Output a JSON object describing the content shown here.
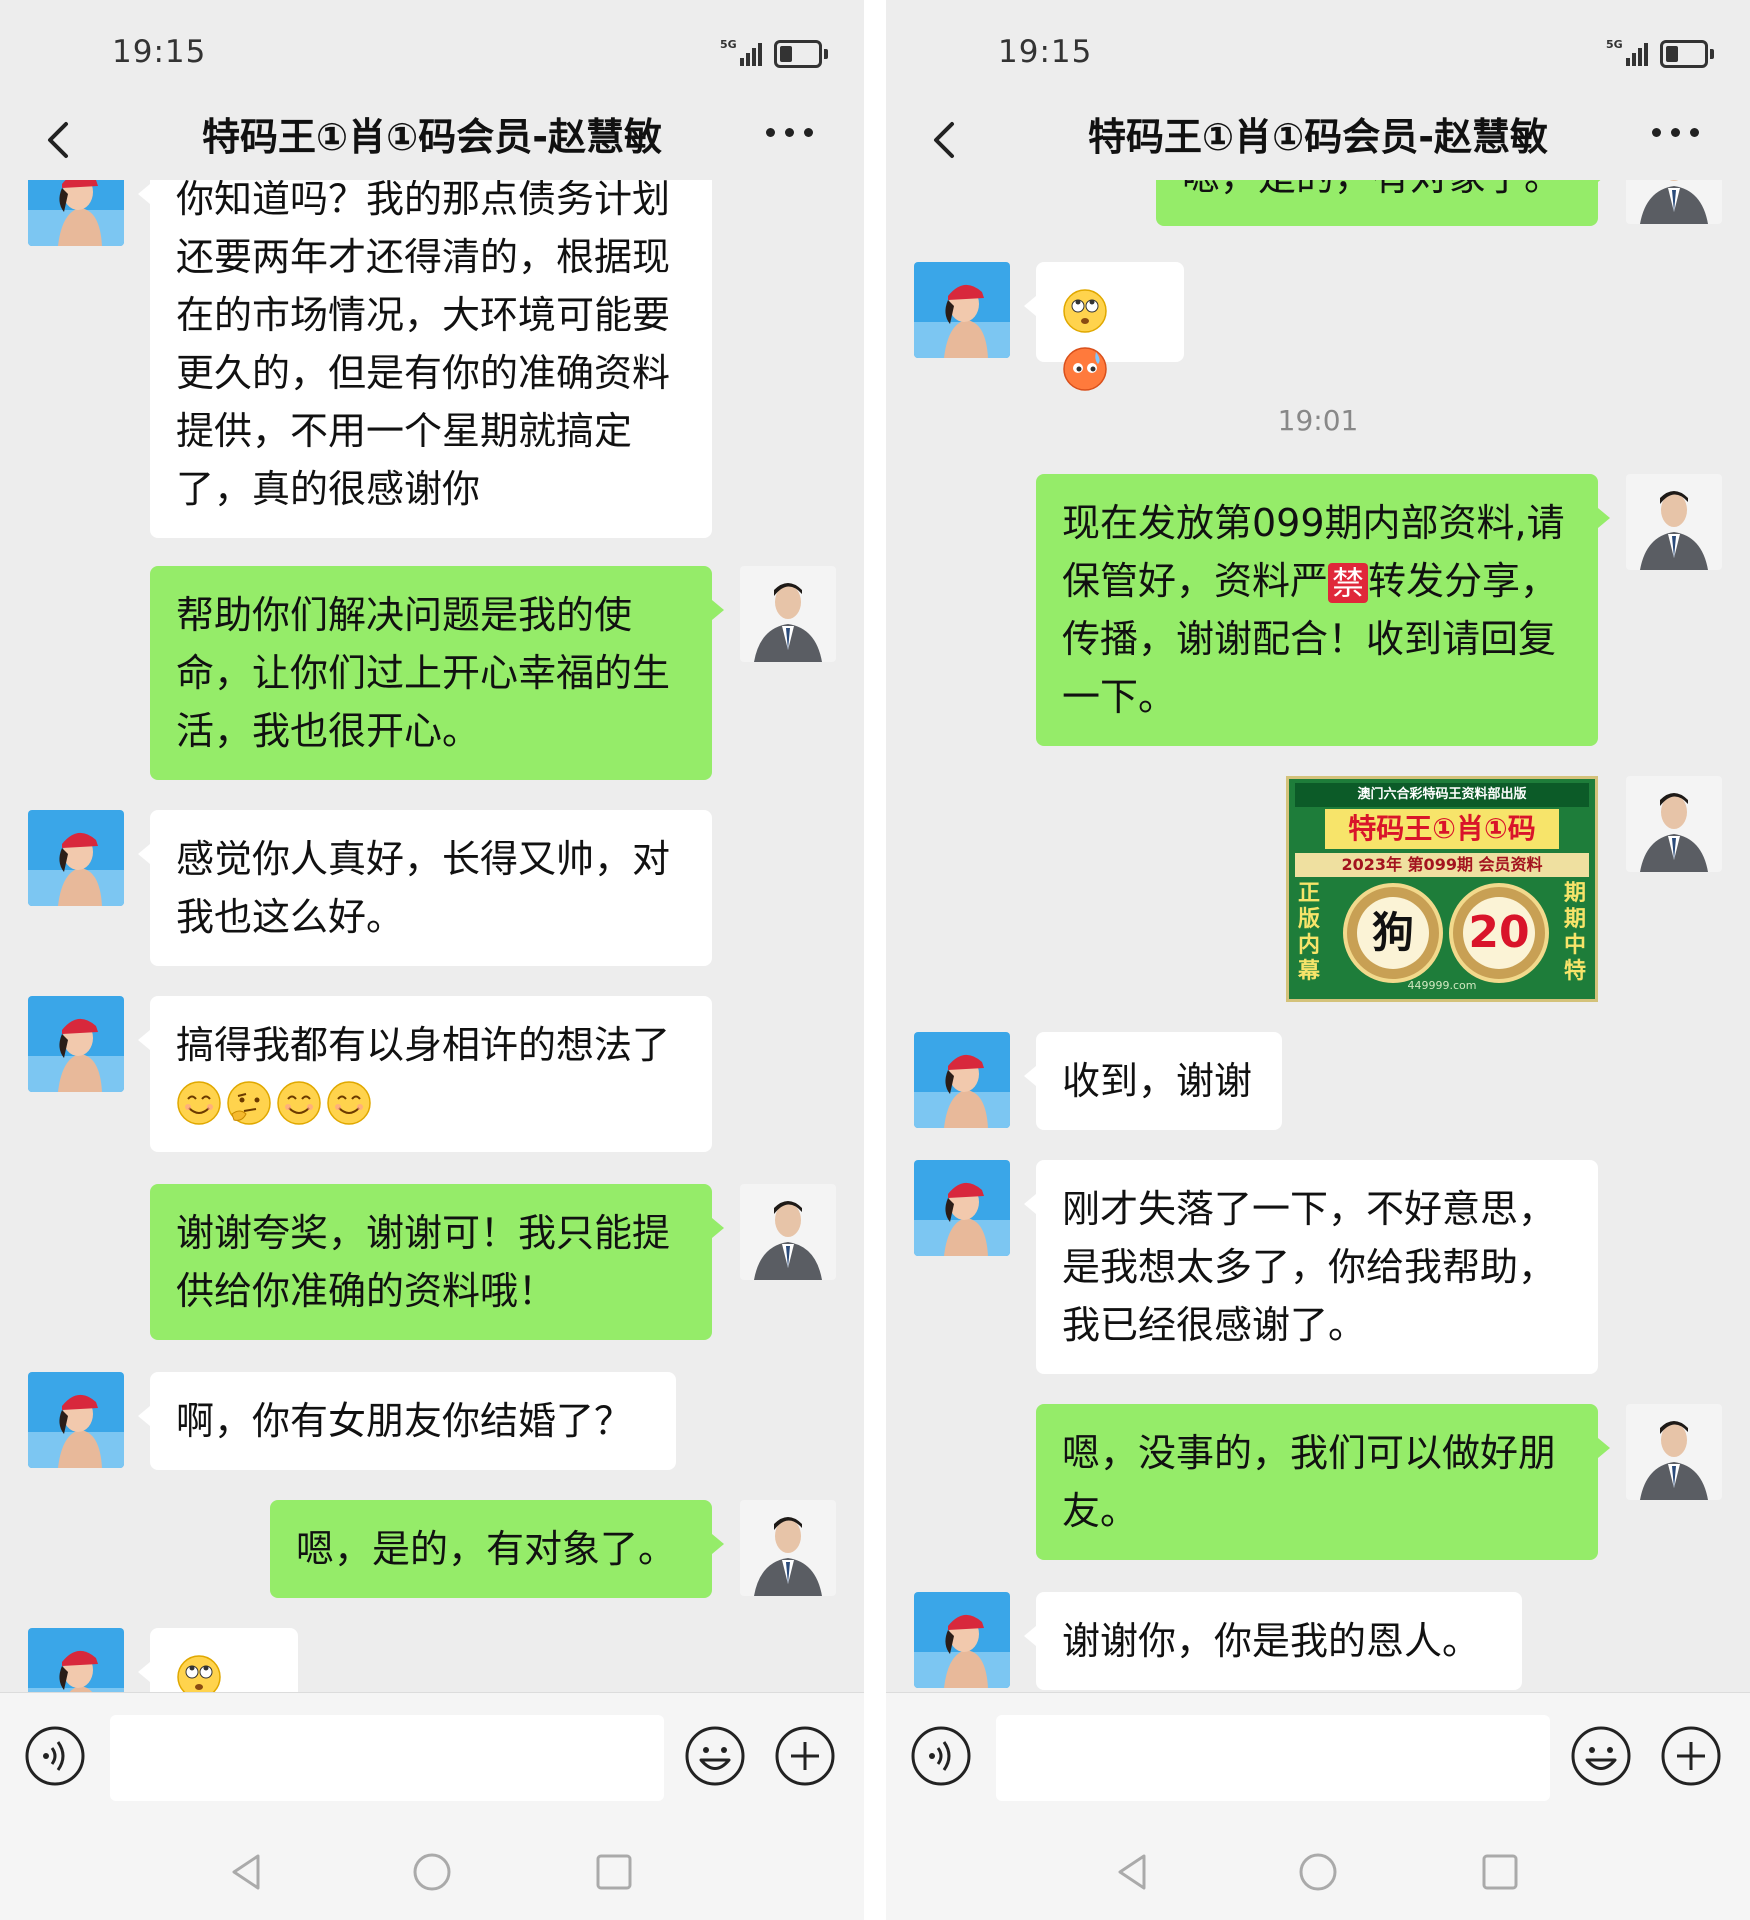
{
  "screens": [
    {
      "time": "19:15",
      "title": "特码王①肖①码会员-赵慧敏",
      "messages": {
        "m1": "你知道吗？我的那点债务计划还要两年才还得清的，根据现在的市场情况，大环境可能要更久的，但是有你的准确资料提供，不用一个星期就搞定了，真的很感谢你",
        "m2": "帮助你们解决问题是我的使命，让你们过上开心幸福的生活，我也很开心。",
        "m3": "感觉你人真好，长得又帅，对我也这么好。",
        "m4": "搞得我都有以身相许的想法了",
        "m5": "谢谢夸奖，谢谢可！我只能提供给你准确的资料哦！",
        "m6": "啊，你有女朋友你结婚了？",
        "m7": "嗯，是的，有对象了。"
      },
      "input_placeholder": ""
    },
    {
      "time": "19:15",
      "title": "特码王①肖①码会员-赵慧敏",
      "messages": {
        "m0": "嗯，是的，有对象了。",
        "timestamp": "19:01",
        "m2_a": "现在发放第099期内部资料,请保管好，资料严",
        "m2_jin": "禁",
        "m2_b": "转发分享，传播，谢谢配合！收到请回复一下。",
        "m3": "收到，谢谢",
        "m4": "刚才失落了一下，不好意思，是我想太多了，你给我帮助，我已经很感谢了。",
        "m5": "嗯，没事的，我们可以做好朋友。",
        "m6": "谢谢你，你是我的恩人。"
      },
      "image": {
        "header": "澳门六合彩特码王资料部出版",
        "title": "特码王①肖①码",
        "issue": "2023年 第099期 会员资料",
        "left_vertical": "正版内幕",
        "right_vertical": "期期中特",
        "zodiac": "狗",
        "number": "20",
        "footer": "449999.com"
      },
      "input_placeholder": ""
    }
  ],
  "colors": {
    "background": "#ededed",
    "bubble_out": "#95ec69",
    "bubble_in": "#ffffff"
  },
  "icons": [
    "back-icon",
    "more-icon",
    "voice-icon",
    "emoji-icon",
    "plus-icon",
    "nav-back-icon",
    "nav-home-icon",
    "nav-recent-icon"
  ]
}
